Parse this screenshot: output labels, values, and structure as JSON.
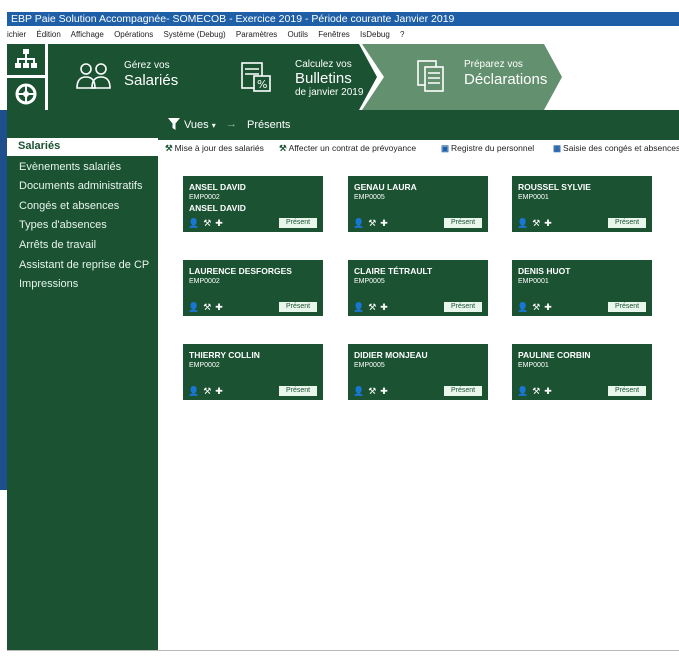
{
  "window": {
    "title": "EBP Paie Solution Accompagnée- SOMECOB - Exercice 2019 - Période courante Janvier 2019"
  },
  "menu": [
    "ichier",
    "Édition",
    "Affichage",
    "Opérations",
    "Système (Debug)",
    "Paramètres",
    "Outils",
    "Fenêtres",
    "IsDebug",
    "?"
  ],
  "steps": [
    {
      "small": "Gérez vos",
      "big": "Salariés",
      "icon": "people-icon"
    },
    {
      "small": "Calculez vos",
      "big": "Bulletins",
      "sub": "de janvier 2019",
      "icon": "payslip-icon"
    },
    {
      "small": "Préparez vos",
      "big": "Déclarations",
      "icon": "declarations-icon"
    }
  ],
  "sidebar": {
    "selected": "Salariés",
    "items": [
      "Evènements salariés",
      "Documents administratifs",
      "Congés et absences",
      "Types d'absences",
      "Arrêts de travail",
      "Assistant de reprise de CP",
      "Impressions"
    ]
  },
  "viewbar": {
    "vues": "Vues",
    "arrow": "→",
    "filter": "Présents"
  },
  "actions": [
    "Mise à jour des salariés",
    "Affecter un contrat de prévoyance",
    "Registre du personnel",
    "Saisie des congés et absences"
  ],
  "cards": [
    {
      "name": "ANSEL DAVID",
      "emp": "EMP0002",
      "name2": "ANSEL DAVID",
      "status": "Présent"
    },
    {
      "name": "GENAU LAURA",
      "emp": "EMP0005",
      "status": "Présent"
    },
    {
      "name": "ROUSSEL SYLVIE",
      "emp": "EMP0001",
      "status": "Présent"
    },
    {
      "name": "LAURENCE DESFORGES",
      "emp": "EMP0002",
      "status": "Présent"
    },
    {
      "name": "CLAIRE TÉTRAULT",
      "emp": "EMP0005",
      "status": "Présent"
    },
    {
      "name": "DENIS HUOT",
      "emp": "EMP0001",
      "status": "Présent"
    },
    {
      "name": "THIERRY COLLIN",
      "emp": "EMP0002",
      "status": "Présent"
    },
    {
      "name": "DIDIER MONJEAU",
      "emp": "EMP0005",
      "status": "Présent"
    },
    {
      "name": "PAULINE CORBIN",
      "emp": "EMP0001",
      "status": "Présent"
    }
  ],
  "colors": {
    "brand_green": "#1a5232",
    "light_green": "#63906e",
    "title_blue": "#1e5fa8"
  }
}
